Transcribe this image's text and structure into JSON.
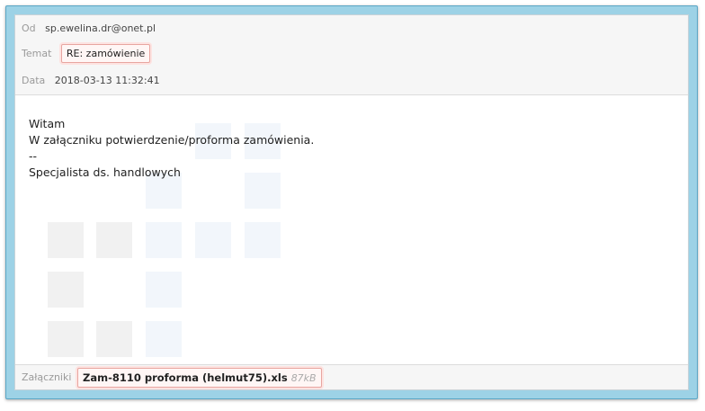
{
  "header": {
    "from": {
      "label": "Od",
      "value": "sp.ewelina.dr@onet.pl"
    },
    "subject": {
      "label": "Temat",
      "value": "RE: zamówienie"
    },
    "date": {
      "label": "Data",
      "value": "2018-03-13 11:32:41"
    }
  },
  "message": {
    "lines": [
      "Witam",
      "W załączniku potwierdzenie/proforma zamówienia.",
      "--",
      "Specjalista ds. handlowych"
    ]
  },
  "attachments": {
    "label": "Załączniki",
    "items": [
      {
        "name": "Zam-8110 proforma (helmut75).xls",
        "size": "87kB"
      }
    ]
  },
  "colors": {
    "frame": "#9dd2e6",
    "highlight_border": "#e8a5a0",
    "header_bg": "#f6f6f6"
  }
}
